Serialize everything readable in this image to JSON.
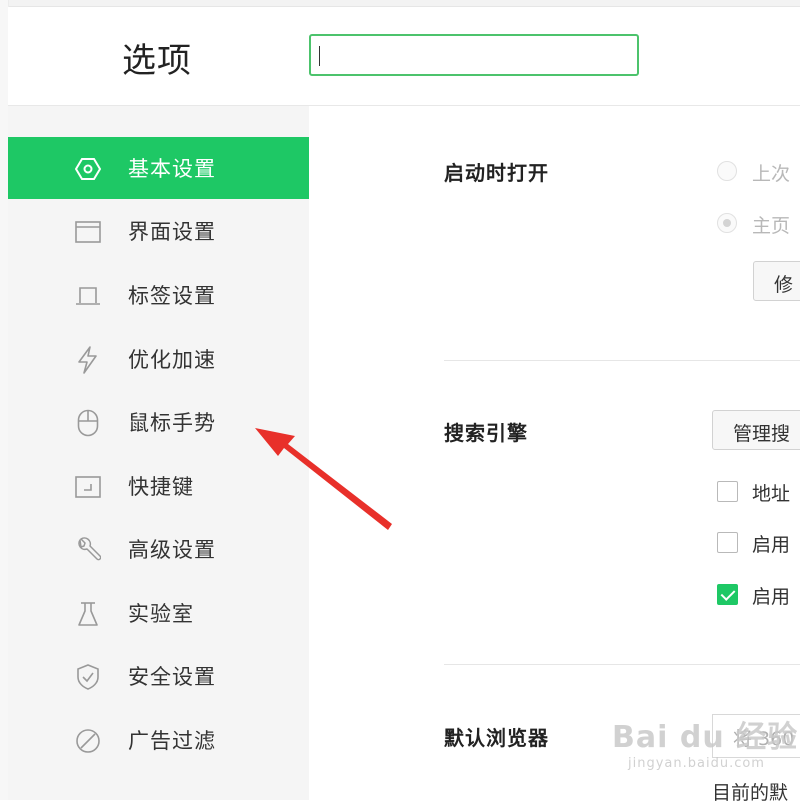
{
  "header": {
    "title": "选项",
    "search_value": ""
  },
  "sidebar": {
    "items": [
      {
        "label": "基本设置",
        "icon": "hexagon-settings-icon",
        "active": true
      },
      {
        "label": "界面设置",
        "icon": "window-icon",
        "active": false
      },
      {
        "label": "标签设置",
        "icon": "tab-icon",
        "active": false
      },
      {
        "label": "优化加速",
        "icon": "lightning-icon",
        "active": false
      },
      {
        "label": "鼠标手势",
        "icon": "mouse-icon",
        "active": false
      },
      {
        "label": "快捷键",
        "icon": "keyboard-icon",
        "active": false
      },
      {
        "label": "高级设置",
        "icon": "wrench-icon",
        "active": false
      },
      {
        "label": "实验室",
        "icon": "flask-icon",
        "active": false
      },
      {
        "label": "安全设置",
        "icon": "shield-icon",
        "active": false
      },
      {
        "label": "广告过滤",
        "icon": "block-icon",
        "active": false
      }
    ]
  },
  "startup": {
    "title": "启动时打开",
    "options": [
      {
        "label": "上次",
        "checked": false
      },
      {
        "label": "主页",
        "checked": true
      }
    ],
    "modify_button": "修"
  },
  "search_engine": {
    "title": "搜索引擎",
    "manage_button": "管理搜",
    "checkboxes": [
      {
        "label": "地址",
        "checked": false
      },
      {
        "label": "启用",
        "checked": false
      },
      {
        "label": "启用",
        "checked": true
      }
    ]
  },
  "default_browser": {
    "title": "默认浏览器",
    "input_text": "将 360",
    "note": "目前的默"
  },
  "watermark": {
    "main": "Bai du 经验",
    "sub": "jingyan.baidu.com"
  },
  "colors": {
    "accent": "#1ec865",
    "search_border": "#4cc36c",
    "arrow": "#e8302a"
  }
}
